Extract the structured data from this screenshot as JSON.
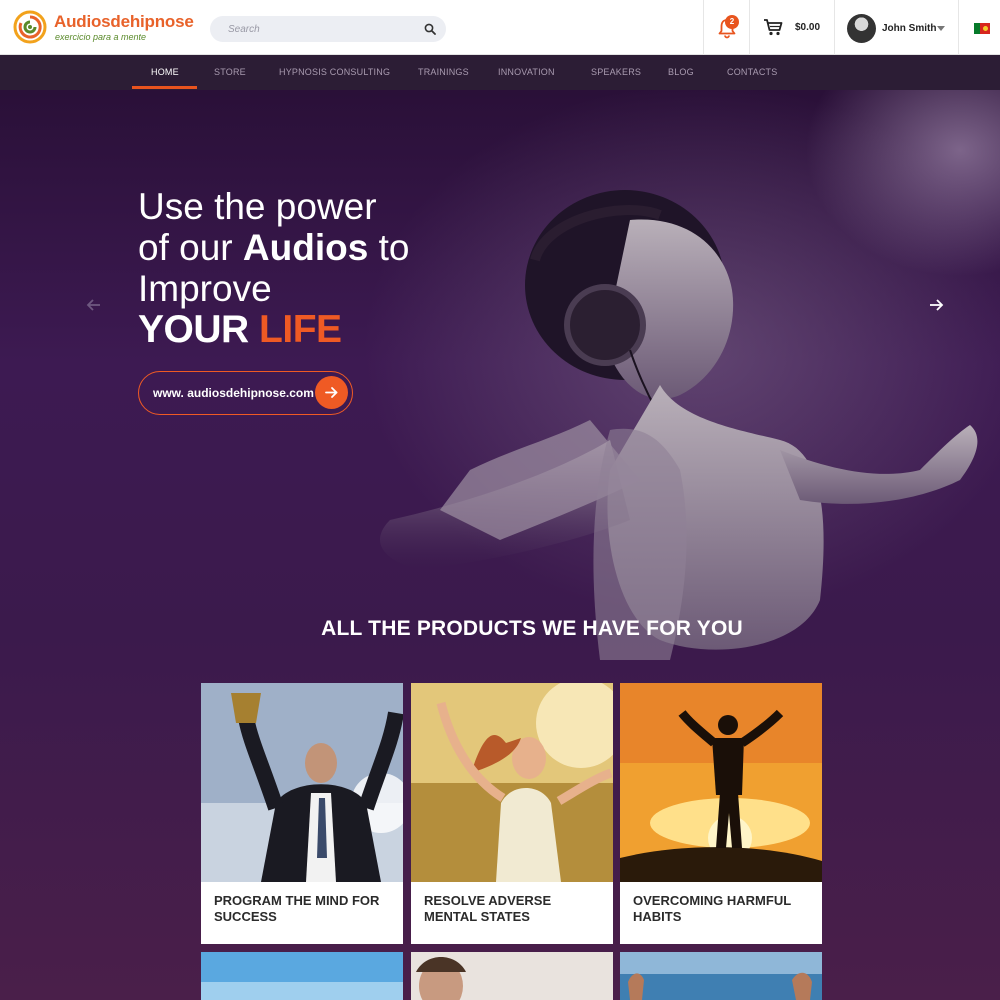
{
  "brand": {
    "name": "Audiosdehipnose",
    "tagline": "exercicio para a mente"
  },
  "search": {
    "placeholder": "Search"
  },
  "notifications": {
    "count": "2"
  },
  "cart": {
    "total": "$0.00"
  },
  "user": {
    "name": "John Smith"
  },
  "nav": {
    "items": [
      {
        "label": "HOME",
        "active": true
      },
      {
        "label": "STORE"
      },
      {
        "label": "HYPNOSIS CONSULTING"
      },
      {
        "label": "TRAININGS"
      },
      {
        "label": "INNOVATION"
      },
      {
        "label": "SPEAKERS"
      },
      {
        "label": "BLOG"
      },
      {
        "label": "CONTACTS"
      }
    ]
  },
  "hero": {
    "line1": "Use the power",
    "line2_pre": "of our ",
    "line2_bold": "Audios",
    "line2_post": " to",
    "line3": "Improve",
    "big_white": "YOUR",
    "big_orange": "LIFE",
    "cta_text": "www. audiosdehipnose.com"
  },
  "section": {
    "title": "ALL THE PRODUCTS WE HAVE FOR YOU"
  },
  "products": [
    {
      "title": "PROGRAM THE MIND FOR SUCCESS"
    },
    {
      "title": "RESOLVE ADVERSE MENTAL STATES"
    },
    {
      "title": "OVERCOMING HARMFUL HABITS"
    }
  ],
  "colors": {
    "accent": "#ef5a24",
    "nav_bg": "#2c1d35",
    "hero_bg": "#3d1a52"
  }
}
